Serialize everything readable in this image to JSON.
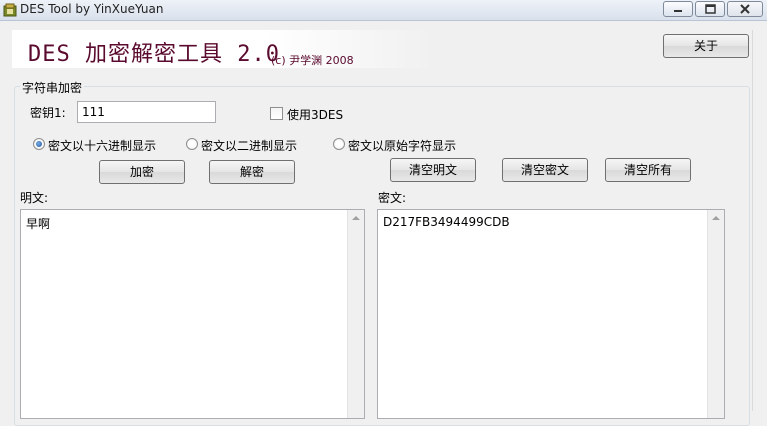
{
  "window": {
    "title": "DES Tool by YinXueYuan",
    "controls": {
      "minimize": "minimize-icon",
      "maximize": "maximize-icon",
      "close": "close-icon"
    }
  },
  "banner": {
    "title": "DES 加密解密工具 2.0",
    "copyright": "(c) 尹学渊 2008"
  },
  "about_button": "关于",
  "group": {
    "title": "字符串加密",
    "key_label": "密钥1:",
    "key_value": "111",
    "use_3des_label": "使用3DES",
    "use_3des_checked": false,
    "output_format_options": [
      {
        "label": "密文以十六进制显示",
        "selected": true
      },
      {
        "label": "密文以二进制显示",
        "selected": false
      },
      {
        "label": "密文以原始字符显示",
        "selected": false
      }
    ],
    "buttons": {
      "encrypt": "加密",
      "decrypt": "解密",
      "clear_plaintext": "清空明文",
      "clear_ciphertext": "清空密文",
      "clear_all": "清空所有"
    },
    "plaintext_label": "明文:",
    "plaintext_value": "早啊",
    "ciphertext_label": "密文:",
    "ciphertext_value": "D217FB3494499CDB"
  },
  "colors": {
    "banner_text": "#5a0a2e",
    "radio_selected": "#1b4f9a"
  }
}
